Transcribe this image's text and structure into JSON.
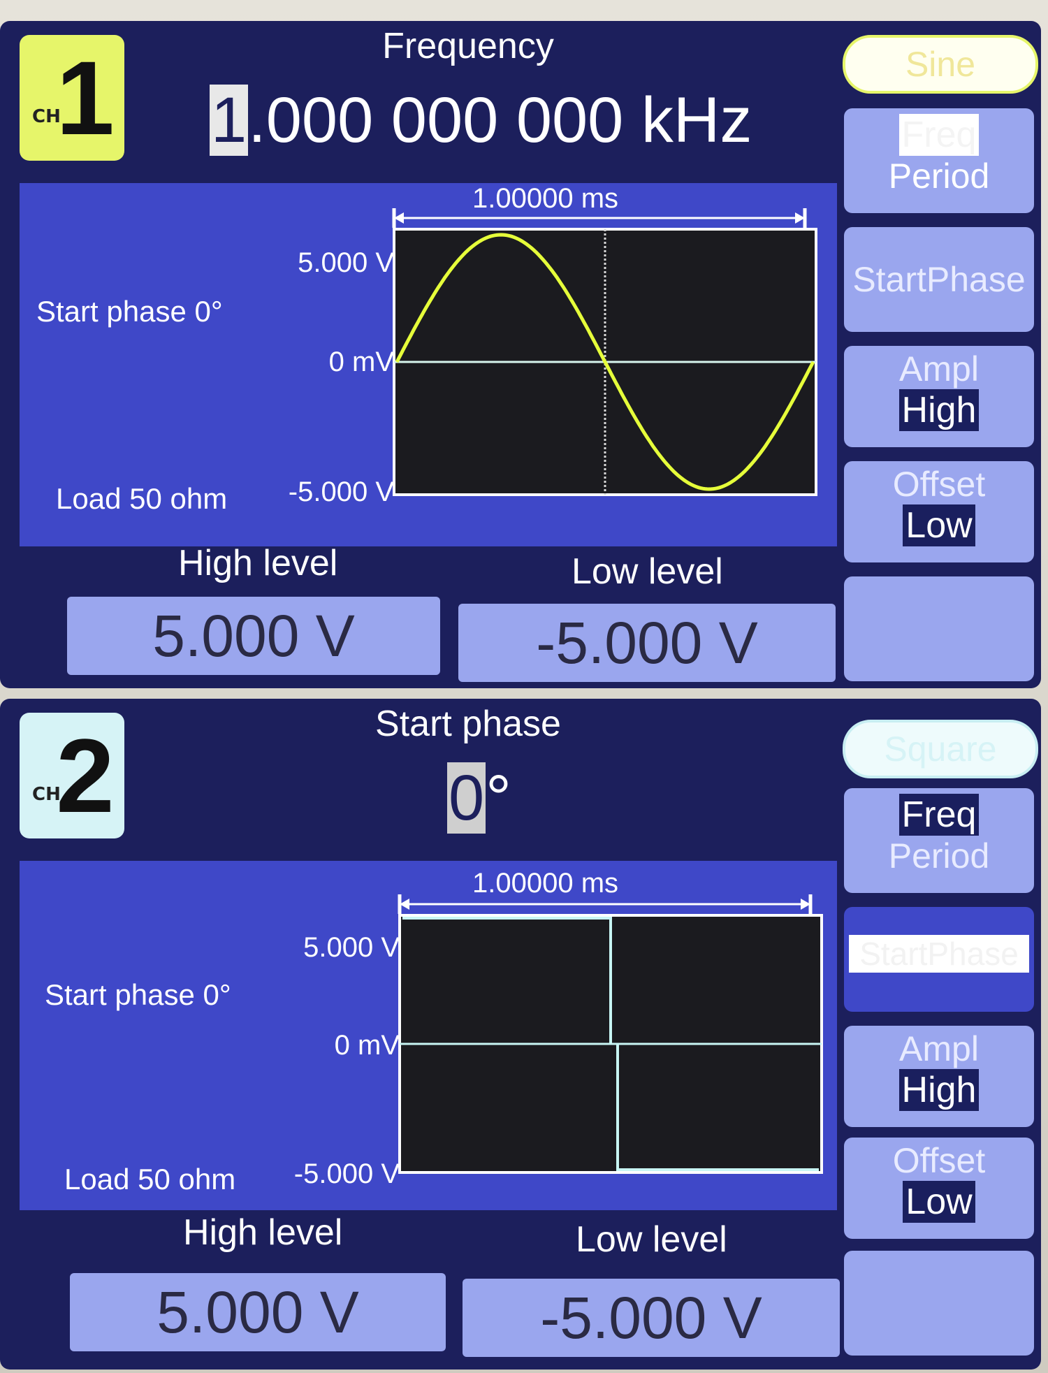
{
  "channel1": {
    "channel_number": "1",
    "channel_tag": "CH",
    "badge_color": "#e6f56a",
    "title": "Frequency",
    "value_cursor_char": "1",
    "value_rest": ".000 000 000 kHz",
    "waveform_button": "Sine",
    "softkeys": {
      "freq": "Freq",
      "period": "Period",
      "start_phase": "StartPhase",
      "ampl": "Ampl",
      "high": "High",
      "offset": "Offset",
      "low": "Low"
    },
    "plot": {
      "time_span": "1.00000 ms",
      "y_top": "5.000 V",
      "y_mid": "0 mV",
      "y_bottom": "-5.000 V",
      "start_phase_label": "Start phase 0°",
      "load_label": "Load 50 ohm",
      "trace_color": "#e6ff3a"
    },
    "high_level_title": "High level",
    "high_level_value": "5.000 V",
    "low_level_title": "Low level",
    "low_level_value": "-5.000 V"
  },
  "channel2": {
    "channel_number": "2",
    "channel_tag": "CH",
    "badge_color": "#d6f3f6",
    "title": "Start phase",
    "value_cursor_char": "0",
    "value_rest": "°",
    "waveform_button": "Square",
    "softkeys": {
      "freq": "Freq",
      "period": "Period",
      "start_phase": "StartPhase",
      "ampl": "Ampl",
      "high": "High",
      "offset": "Offset",
      "low": "Low"
    },
    "plot": {
      "time_span": "1.00000 ms",
      "y_top": "5.000 V",
      "y_mid": "0 mV",
      "y_bottom": "-5.000 V",
      "start_phase_label": "Start phase 0°",
      "load_label": "Load 50 ohm",
      "trace_color": "#c8f6f4"
    },
    "high_level_title": "High level",
    "high_level_value": "5.000 V",
    "low_level_title": "Low level",
    "low_level_value": "-5.000 V"
  }
}
